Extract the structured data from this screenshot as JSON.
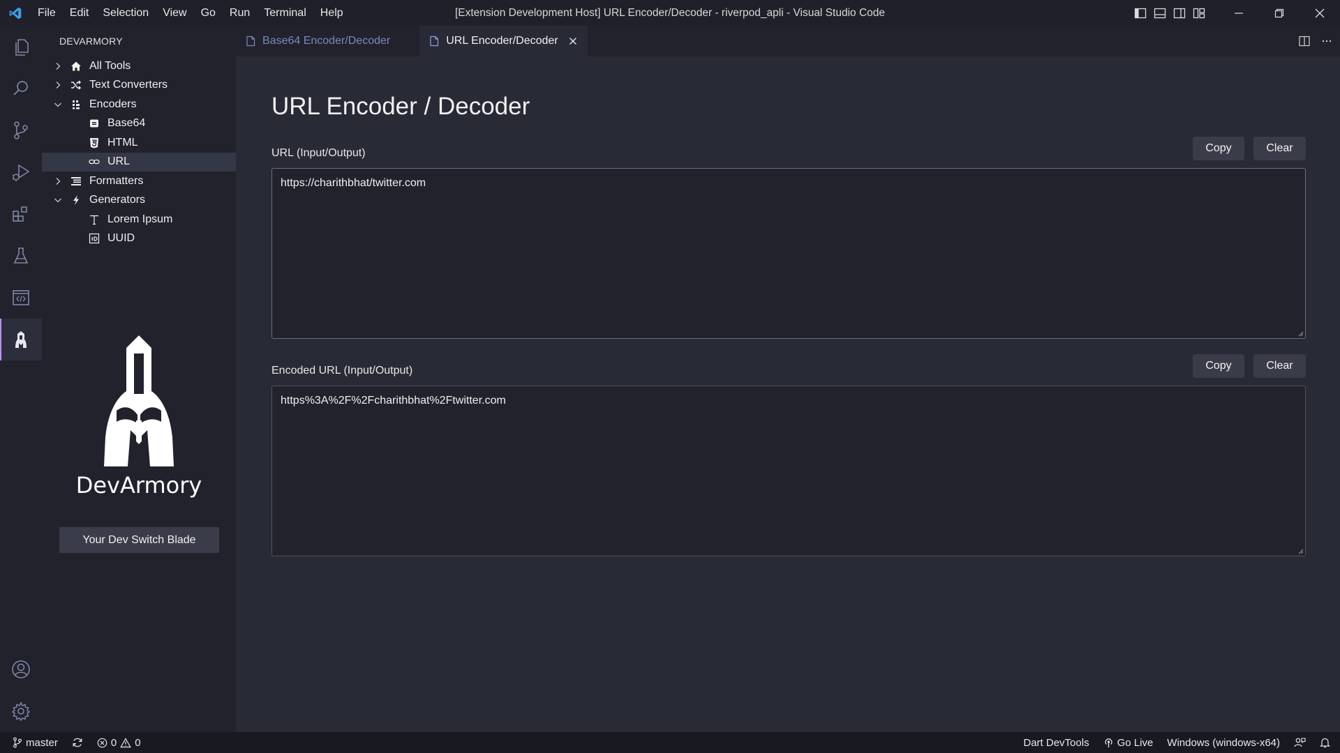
{
  "titlebar": {
    "menu": [
      "File",
      "Edit",
      "Selection",
      "View",
      "Go",
      "Run",
      "Terminal",
      "Help"
    ],
    "window_title": "[Extension Development Host] URL Encoder/Decoder - riverpod_apli - Visual Studio Code"
  },
  "activitybar": {
    "items": [
      "explorer-icon",
      "search-icon",
      "source-control-icon",
      "run-debug-icon",
      "extensions-icon",
      "testing-icon",
      "remote-explorer-icon",
      "devarmory-icon"
    ],
    "bottom": [
      "account-icon",
      "settings-gear-icon"
    ]
  },
  "sidebar": {
    "title": "DEVARMORY",
    "tree": [
      {
        "label": "All Tools",
        "icon": "home-icon",
        "expanded": false
      },
      {
        "label": "Text Converters",
        "icon": "shuffle-icon",
        "expanded": false
      },
      {
        "label": "Encoders",
        "icon": "encoders-icon",
        "expanded": true
      },
      {
        "label": "Base64",
        "icon": "base64-icon"
      },
      {
        "label": "HTML",
        "icon": "html5-icon"
      },
      {
        "label": "URL",
        "icon": "link-icon",
        "selected": true
      },
      {
        "label": "Formatters",
        "icon": "list-icon",
        "expanded": false
      },
      {
        "label": "Generators",
        "icon": "bolt-icon",
        "expanded": true
      },
      {
        "label": "Lorem Ipsum",
        "icon": "text-t-icon"
      },
      {
        "label": "UUID",
        "icon": "id-icon"
      }
    ],
    "brand_name": "DevArmory",
    "tagline": "Your Dev Switch Blade"
  },
  "tabs": [
    {
      "label": "Base64 Encoder/Decoder",
      "active": false
    },
    {
      "label": "URL Encoder/Decoder",
      "active": true
    }
  ],
  "editor": {
    "title": "URL Encoder / Decoder",
    "input_label": "URL (Input/Output)",
    "input_value": "https://charithbhat/twitter.com",
    "output_label": "Encoded URL (Input/Output)",
    "output_value": "https%3A%2F%2Fcharithbhat%2Ftwitter.com",
    "copy_label": "Copy",
    "clear_label": "Clear"
  },
  "statusbar": {
    "branch": "master",
    "errors": "0",
    "warnings": "0",
    "dart_devtools": "Dart DevTools",
    "go_live": "Go Live",
    "platform": "Windows (windows-x64)"
  },
  "colors": {
    "accent": "#bd93f9",
    "vscode_blue": "#3c9fe8"
  }
}
